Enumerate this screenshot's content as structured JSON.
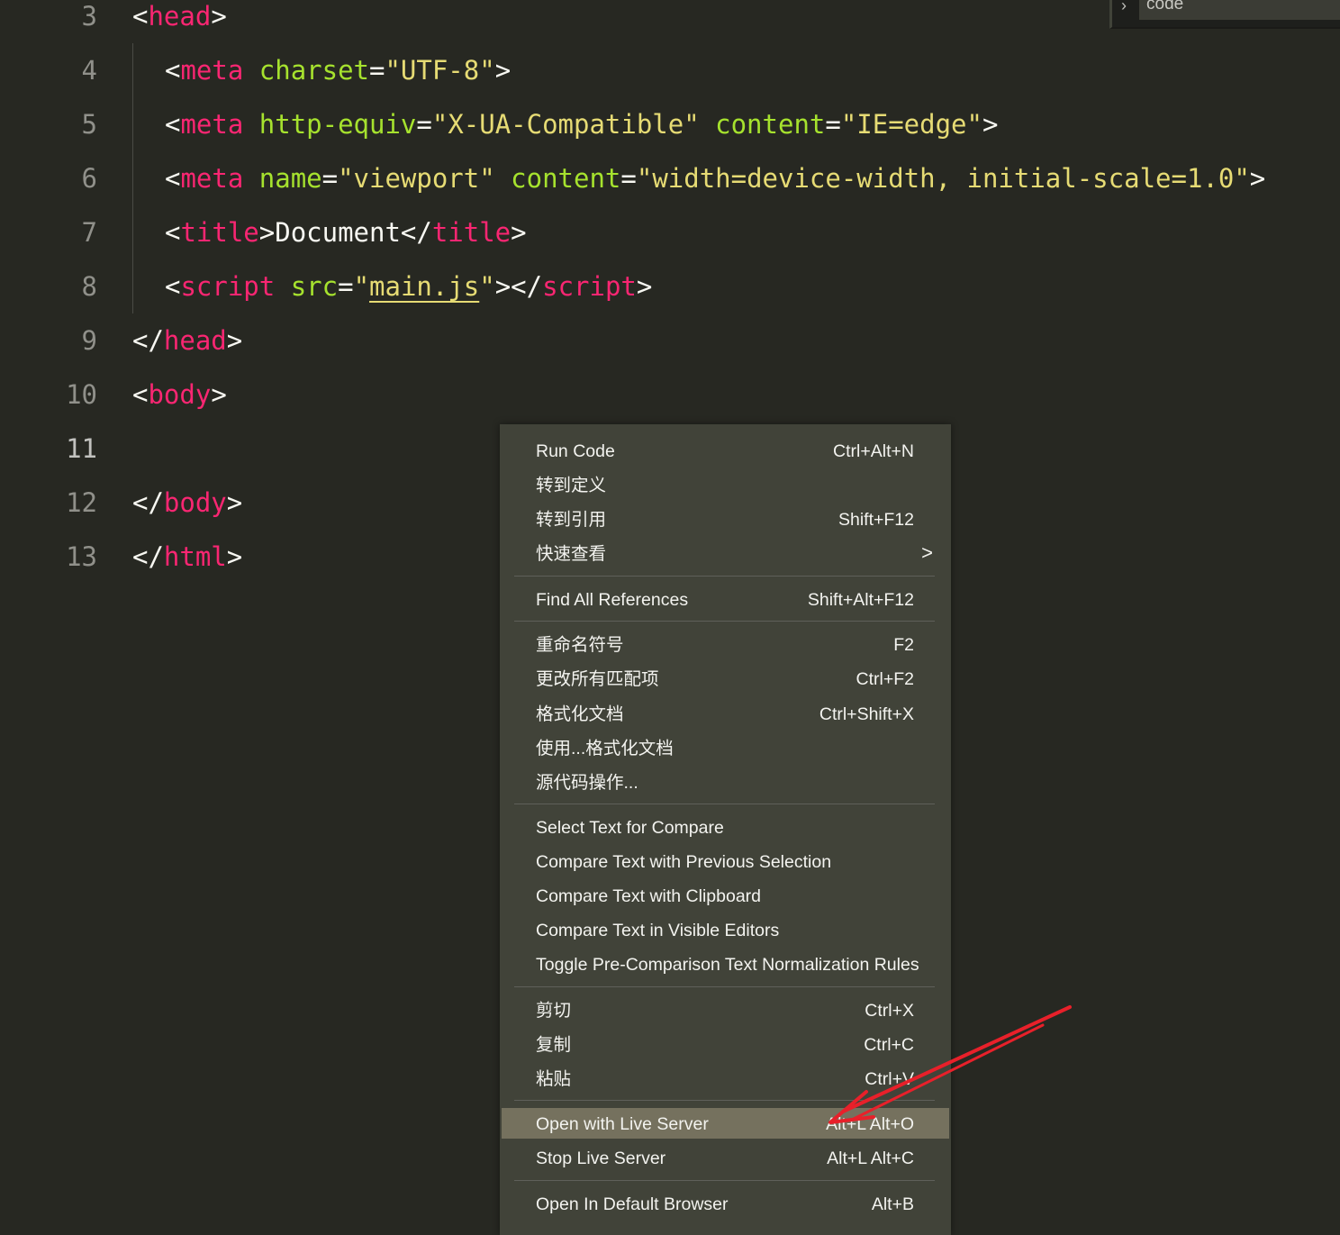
{
  "breadcrumb": {
    "item": "code"
  },
  "editor": {
    "lines": [
      {
        "num": "3",
        "tokens": [
          "<",
          "head",
          ">"
        ]
      },
      {
        "num": "4",
        "tokens": [
          "<",
          "meta",
          " ",
          "charset",
          "=",
          "\"UTF-8\"",
          ">"
        ]
      },
      {
        "num": "5",
        "tokens": [
          "<",
          "meta",
          " ",
          "http-equiv",
          "=",
          "\"X-UA-Compatible\"",
          " ",
          "content",
          "=",
          "\"IE=edge\"",
          ">"
        ]
      },
      {
        "num": "6",
        "tokens": [
          "<",
          "meta",
          " ",
          "name",
          "=",
          "\"viewport\"",
          " ",
          "content",
          "=",
          "\"width=device-width, initial-scale=1.0\"",
          ">"
        ]
      },
      {
        "num": "7",
        "tokens": [
          "<",
          "title",
          ">Document</",
          "title",
          ">"
        ]
      },
      {
        "num": "8",
        "tokens": [
          "<",
          "script",
          " ",
          "src",
          "=",
          "\"",
          "main.js",
          "\"",
          "></",
          "script",
          ">"
        ]
      },
      {
        "num": "9",
        "tokens": [
          "</",
          "head",
          ">"
        ]
      },
      {
        "num": "10",
        "tokens": [
          "<",
          "body",
          ">"
        ]
      },
      {
        "num": "11",
        "tokens": []
      },
      {
        "num": "12",
        "tokens": [
          "</",
          "body",
          ">"
        ]
      },
      {
        "num": "13",
        "tokens": [
          "</",
          "html",
          ">"
        ]
      }
    ]
  },
  "context_menu": {
    "items": [
      {
        "label": "Run Code",
        "key": "Ctrl+Alt+N"
      },
      {
        "label": "转到定义",
        "key": ""
      },
      {
        "label": "转到引用",
        "key": "Shift+F12"
      },
      {
        "label": "快速查看",
        "key": "",
        "submenu": ">"
      },
      {
        "label": "Find All References",
        "key": "Shift+Alt+F12"
      },
      {
        "label": "重命名符号",
        "key": "F2"
      },
      {
        "label": "更改所有匹配项",
        "key": "Ctrl+F2"
      },
      {
        "label": "格式化文档",
        "key": "Ctrl+Shift+X"
      },
      {
        "label": "使用...格式化文档",
        "key": ""
      },
      {
        "label": "源代码操作...",
        "key": ""
      },
      {
        "label": "Select Text for Compare",
        "key": ""
      },
      {
        "label": "Compare Text with Previous Selection",
        "key": ""
      },
      {
        "label": "Compare Text with Clipboard",
        "key": ""
      },
      {
        "label": "Compare Text in Visible Editors",
        "key": ""
      },
      {
        "label": "Toggle Pre-Comparison Text Normalization Rules",
        "key": ""
      },
      {
        "label": "剪切",
        "key": "Ctrl+X"
      },
      {
        "label": "复制",
        "key": "Ctrl+C"
      },
      {
        "label": "粘贴",
        "key": "Ctrl+V"
      },
      {
        "label": "Open with Live Server",
        "key": "Alt+L Alt+O",
        "highlighted": true
      },
      {
        "label": "Stop Live Server",
        "key": "Alt+L Alt+C"
      },
      {
        "label": "Open In Default Browser",
        "key": "Alt+B"
      }
    ]
  },
  "colors": {
    "editor_bg": "#272822",
    "menu_bg": "#414339",
    "highlight_bg": "#75715e",
    "tag": "#f92672",
    "attribute": "#a6e22e",
    "string": "#e6db74",
    "annotation_arrow": "#e8202a"
  }
}
